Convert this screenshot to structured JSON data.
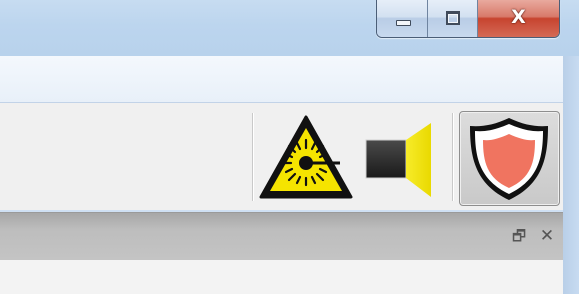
{
  "window": {
    "caption_buttons": {
      "minimize_icon": "minimize-icon",
      "maximize_icon": "maximize-icon",
      "close_glyph": "X"
    }
  },
  "toolbar": {
    "buttons": [
      {
        "icon": "laser-warning-icon",
        "state": "normal"
      },
      {
        "icon": "speaker-icon",
        "state": "normal"
      },
      {
        "icon": "shield-icon",
        "state": "pressed"
      }
    ]
  },
  "panel": {
    "restore_glyph": "🗗",
    "close_glyph": "✕"
  },
  "colors": {
    "titlebar": "#bcd5ee",
    "close_button": "#c7442f",
    "laser_yellow": "#f5e400",
    "speaker_yellow": "#f2e600",
    "shield_fill": "#f07460",
    "panel_header": "#bdbdbd"
  }
}
